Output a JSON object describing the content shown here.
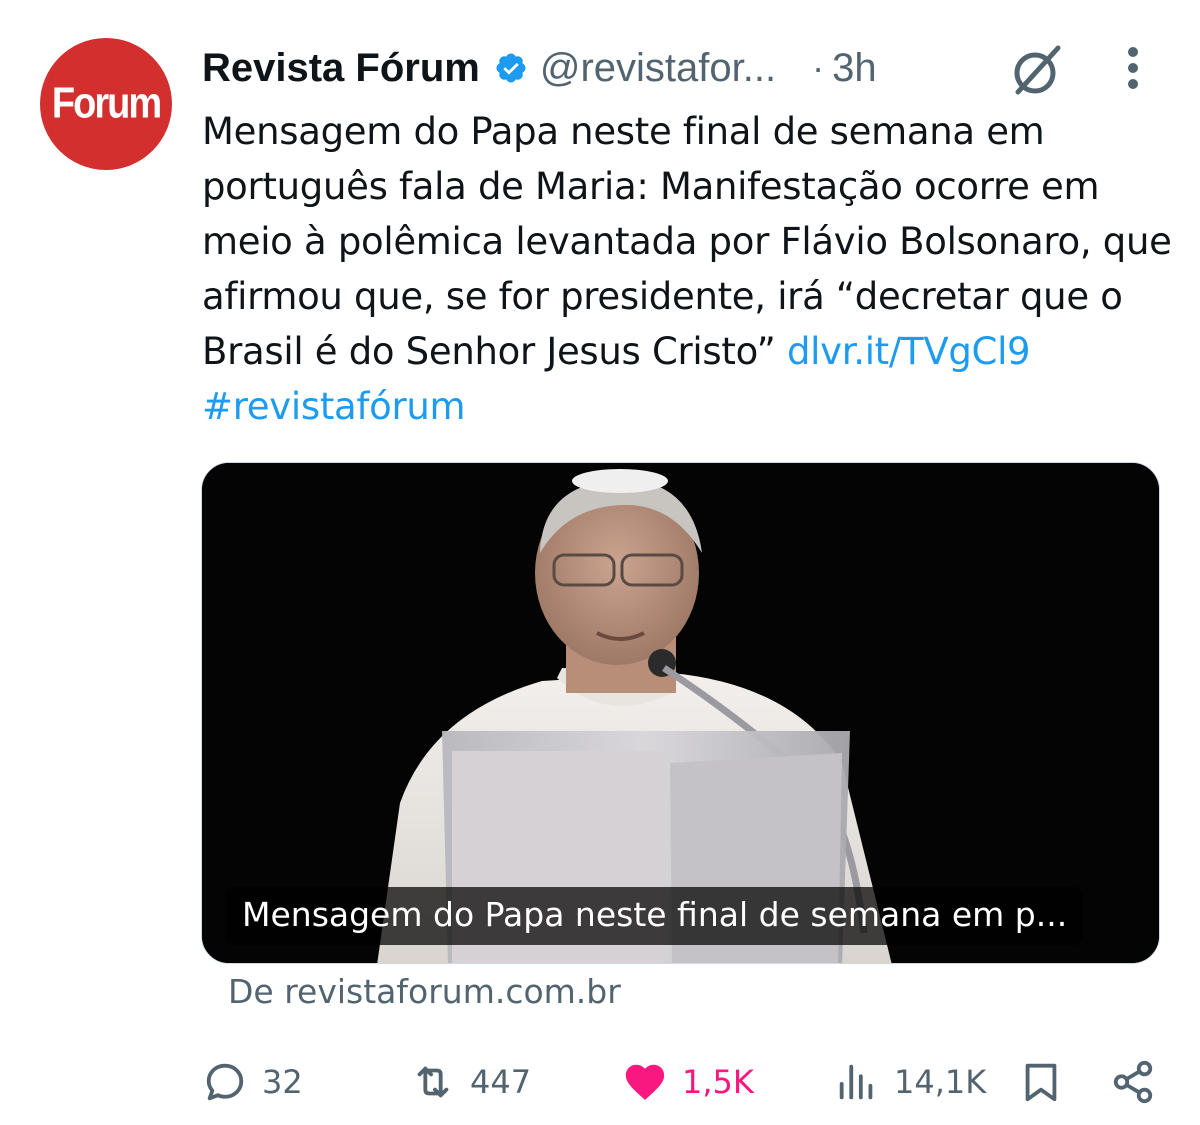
{
  "author": {
    "avatar_text": "Forum",
    "display_name": "Revista Fórum",
    "handle": "@revistafor...",
    "separator": "·",
    "time": "3h"
  },
  "tweet": {
    "text": "Mensagem do Papa neste final de semana em português fala de Maria: Manifestação ocorre em meio à polêmica levantada por Flávio Bolsonaro, que afirmou que, se for presidente, irá “decretar que o Brasil é do Senhor Jesus Cristo”",
    "link": "dlvr.it/TVgCl9",
    "hashtag": "#revistafórum"
  },
  "card": {
    "caption": "Mensagem do Papa neste final de semana em p...",
    "source": "De revistaforum.com.br"
  },
  "actions": {
    "replies": "32",
    "reposts": "447",
    "likes": "1,5K",
    "views": "14,1K"
  },
  "colors": {
    "avatar_bg": "#d32f2f",
    "verified": "#1d9bf0",
    "link": "#1d9bf0",
    "liked": "#f91880",
    "muted": "#536471",
    "text": "#0f1419"
  },
  "icons": {
    "verified": "verified-badge-icon",
    "grok": "grok-icon",
    "more": "more-vertical-icon",
    "reply": "reply-icon",
    "repost": "repost-icon",
    "like": "heart-filled-icon",
    "views": "views-icon",
    "bookmark": "bookmark-icon",
    "share": "share-icon"
  }
}
